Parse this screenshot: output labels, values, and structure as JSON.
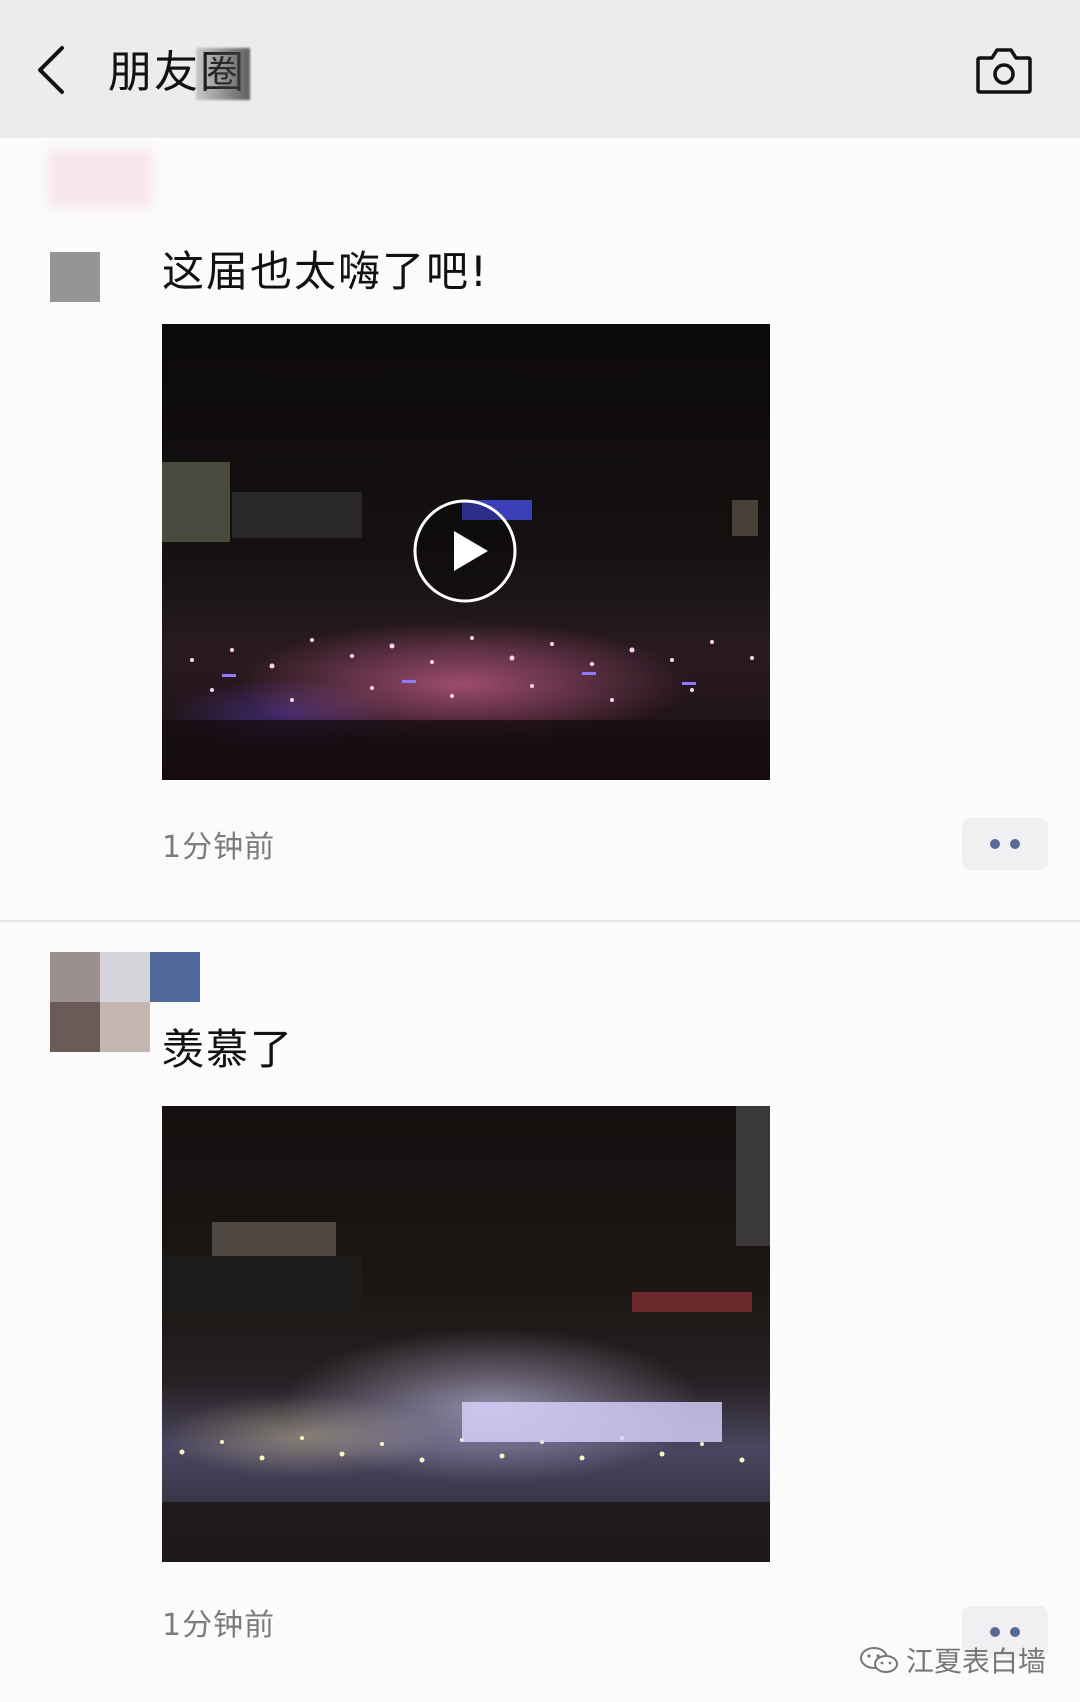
{
  "header": {
    "title": "朋友圈",
    "back_icon": "chevron-left-icon",
    "camera_icon": "camera-icon"
  },
  "posts": [
    {
      "text": "这届也太嗨了吧!",
      "media_type": "video",
      "timestamp": "1分钟前"
    },
    {
      "text": "羡慕了",
      "media_type": "image",
      "timestamp": "1分钟前"
    }
  ],
  "watermark": {
    "text": "江夏表白墙",
    "icon": "wechat-icon"
  },
  "colors": {
    "header_bg": "#ececec",
    "link_blue": "#576b95",
    "timestamp_gray": "#7c7c7c"
  }
}
